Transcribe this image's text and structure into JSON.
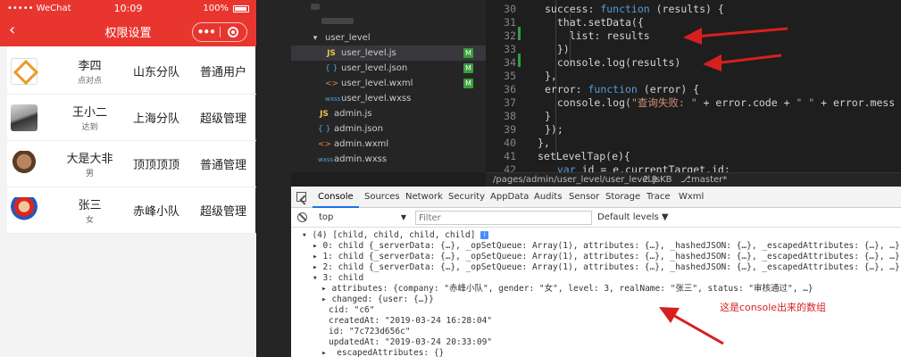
{
  "phone": {
    "status": {
      "carrier": "••••• WeChat",
      "signal_icon": "wifi-icon",
      "time": "10:09",
      "battery": "100%",
      "battery_icon": "battery-icon"
    },
    "nav": {
      "back_icon": "‹",
      "title": "权限设置",
      "menu_icon": "•••"
    },
    "users": [
      {
        "name": "李四",
        "sub": "点对点",
        "team": "山东分队",
        "role": "普通用户",
        "avatar_icon": "company-logo-avatar"
      },
      {
        "name": "王小二",
        "sub": "达到",
        "team": "上海分队",
        "role": "超级管理",
        "avatar_icon": "landscape-avatar"
      },
      {
        "name": "大是大非",
        "sub": "男",
        "team": "顶顶顶顶",
        "role": "普通管理",
        "avatar_icon": "cartoon-avatar"
      },
      {
        "name": "张三",
        "sub": "女",
        "team": "赤峰小队",
        "role": "超级管理",
        "avatar_icon": "mario-avatar"
      }
    ]
  },
  "file_tree": {
    "items": [
      {
        "label": "user_level",
        "icon": "▾",
        "kind": "folder"
      },
      {
        "label": "user_level.js",
        "icon": "JS",
        "kind": "js",
        "badge": "M"
      },
      {
        "label": "user_level.json",
        "icon": "{ }",
        "kind": "json",
        "badge": "M"
      },
      {
        "label": "user_level.wxml",
        "icon": "<>",
        "kind": "wxml",
        "badge": "M"
      },
      {
        "label": "user_level.wxss",
        "icon": "wxss",
        "kind": "wxss"
      },
      {
        "label": "admin.js",
        "icon": "JS",
        "kind": "js"
      },
      {
        "label": "admin.json",
        "icon": "{ }",
        "kind": "json"
      },
      {
        "label": "admin.wxml",
        "icon": "<>",
        "kind": "wxml"
      },
      {
        "label": "admin.wxss",
        "icon": "wxss",
        "kind": "wxss"
      }
    ]
  },
  "editor": {
    "lines": [
      {
        "n": "30",
        "text": "success: function (results) {"
      },
      {
        "n": "31",
        "text": "  that.setData({"
      },
      {
        "n": "32",
        "text": "    list: results"
      },
      {
        "n": "33",
        "text": "  })"
      },
      {
        "n": "34",
        "text": "  console.log(results)"
      },
      {
        "n": "35",
        "text": "},"
      },
      {
        "n": "36",
        "text": "error: function (error) {"
      },
      {
        "n": "37",
        "text": "  console.log(\"查询失败: \" + error.code + \" \" + error.mess"
      },
      {
        "n": "38",
        "text": "}"
      },
      {
        "n": "39",
        "text": "});"
      },
      {
        "n": "40",
        "text": "},"
      },
      {
        "n": "41",
        "text": "setLevelTap(e){"
      },
      {
        "n": "42",
        "text": "  var id = e.currentTarget.id;"
      }
    ],
    "status": {
      "path": "/pages/admin/user_level/user_level.js",
      "size": "2.8 KB",
      "branch": "master*"
    }
  },
  "devtools": {
    "tabs": [
      "Console",
      "Sources",
      "Network",
      "Security",
      "AppData",
      "Audits",
      "Sensor",
      "Storage",
      "Trace",
      "Wxml"
    ],
    "active_tab": "Console",
    "context": "top",
    "filter_placeholder": "Filter",
    "levels": "Default levels ▼",
    "console_lines": [
      "▾ (4) [child, child, child, child]",
      "▸ 0: child {_serverData: {…}, _opSetQueue: Array(1), attributes: {…}, _hashedJSON: {…}, _escapedAttributes: {…}, …}",
      "▸ 1: child {_serverData: {…}, _opSetQueue: Array(1), attributes: {…}, _hashedJSON: {…}, _escapedAttributes: {…}, …}",
      "▸ 2: child {_serverData: {…}, _opSetQueue: Array(1), attributes: {…}, _hashedJSON: {…}, _escapedAttributes: {…}, …}",
      "▾ 3: child",
      "▸ attributes: {company: \"赤峰小队\", gender: \"女\", level: 3, realName: \"张三\", status: \"审核通过\", …}",
      "▸ changed: {user: {…}}",
      "cid: \"c6\"",
      "createdAt: \"2019-03-24 16:28:04\"",
      "id: \"7c723d656c\"",
      "updatedAt: \"2019-03-24 20:33:09\"",
      "▸ _escapedAttributes: {}"
    ]
  },
  "annotation": "这是console出来的数组",
  "colors": {
    "wechat_red": "#e8362f",
    "arrow_red": "#d81f1f",
    "editor_bg": "#1e1e1e"
  }
}
